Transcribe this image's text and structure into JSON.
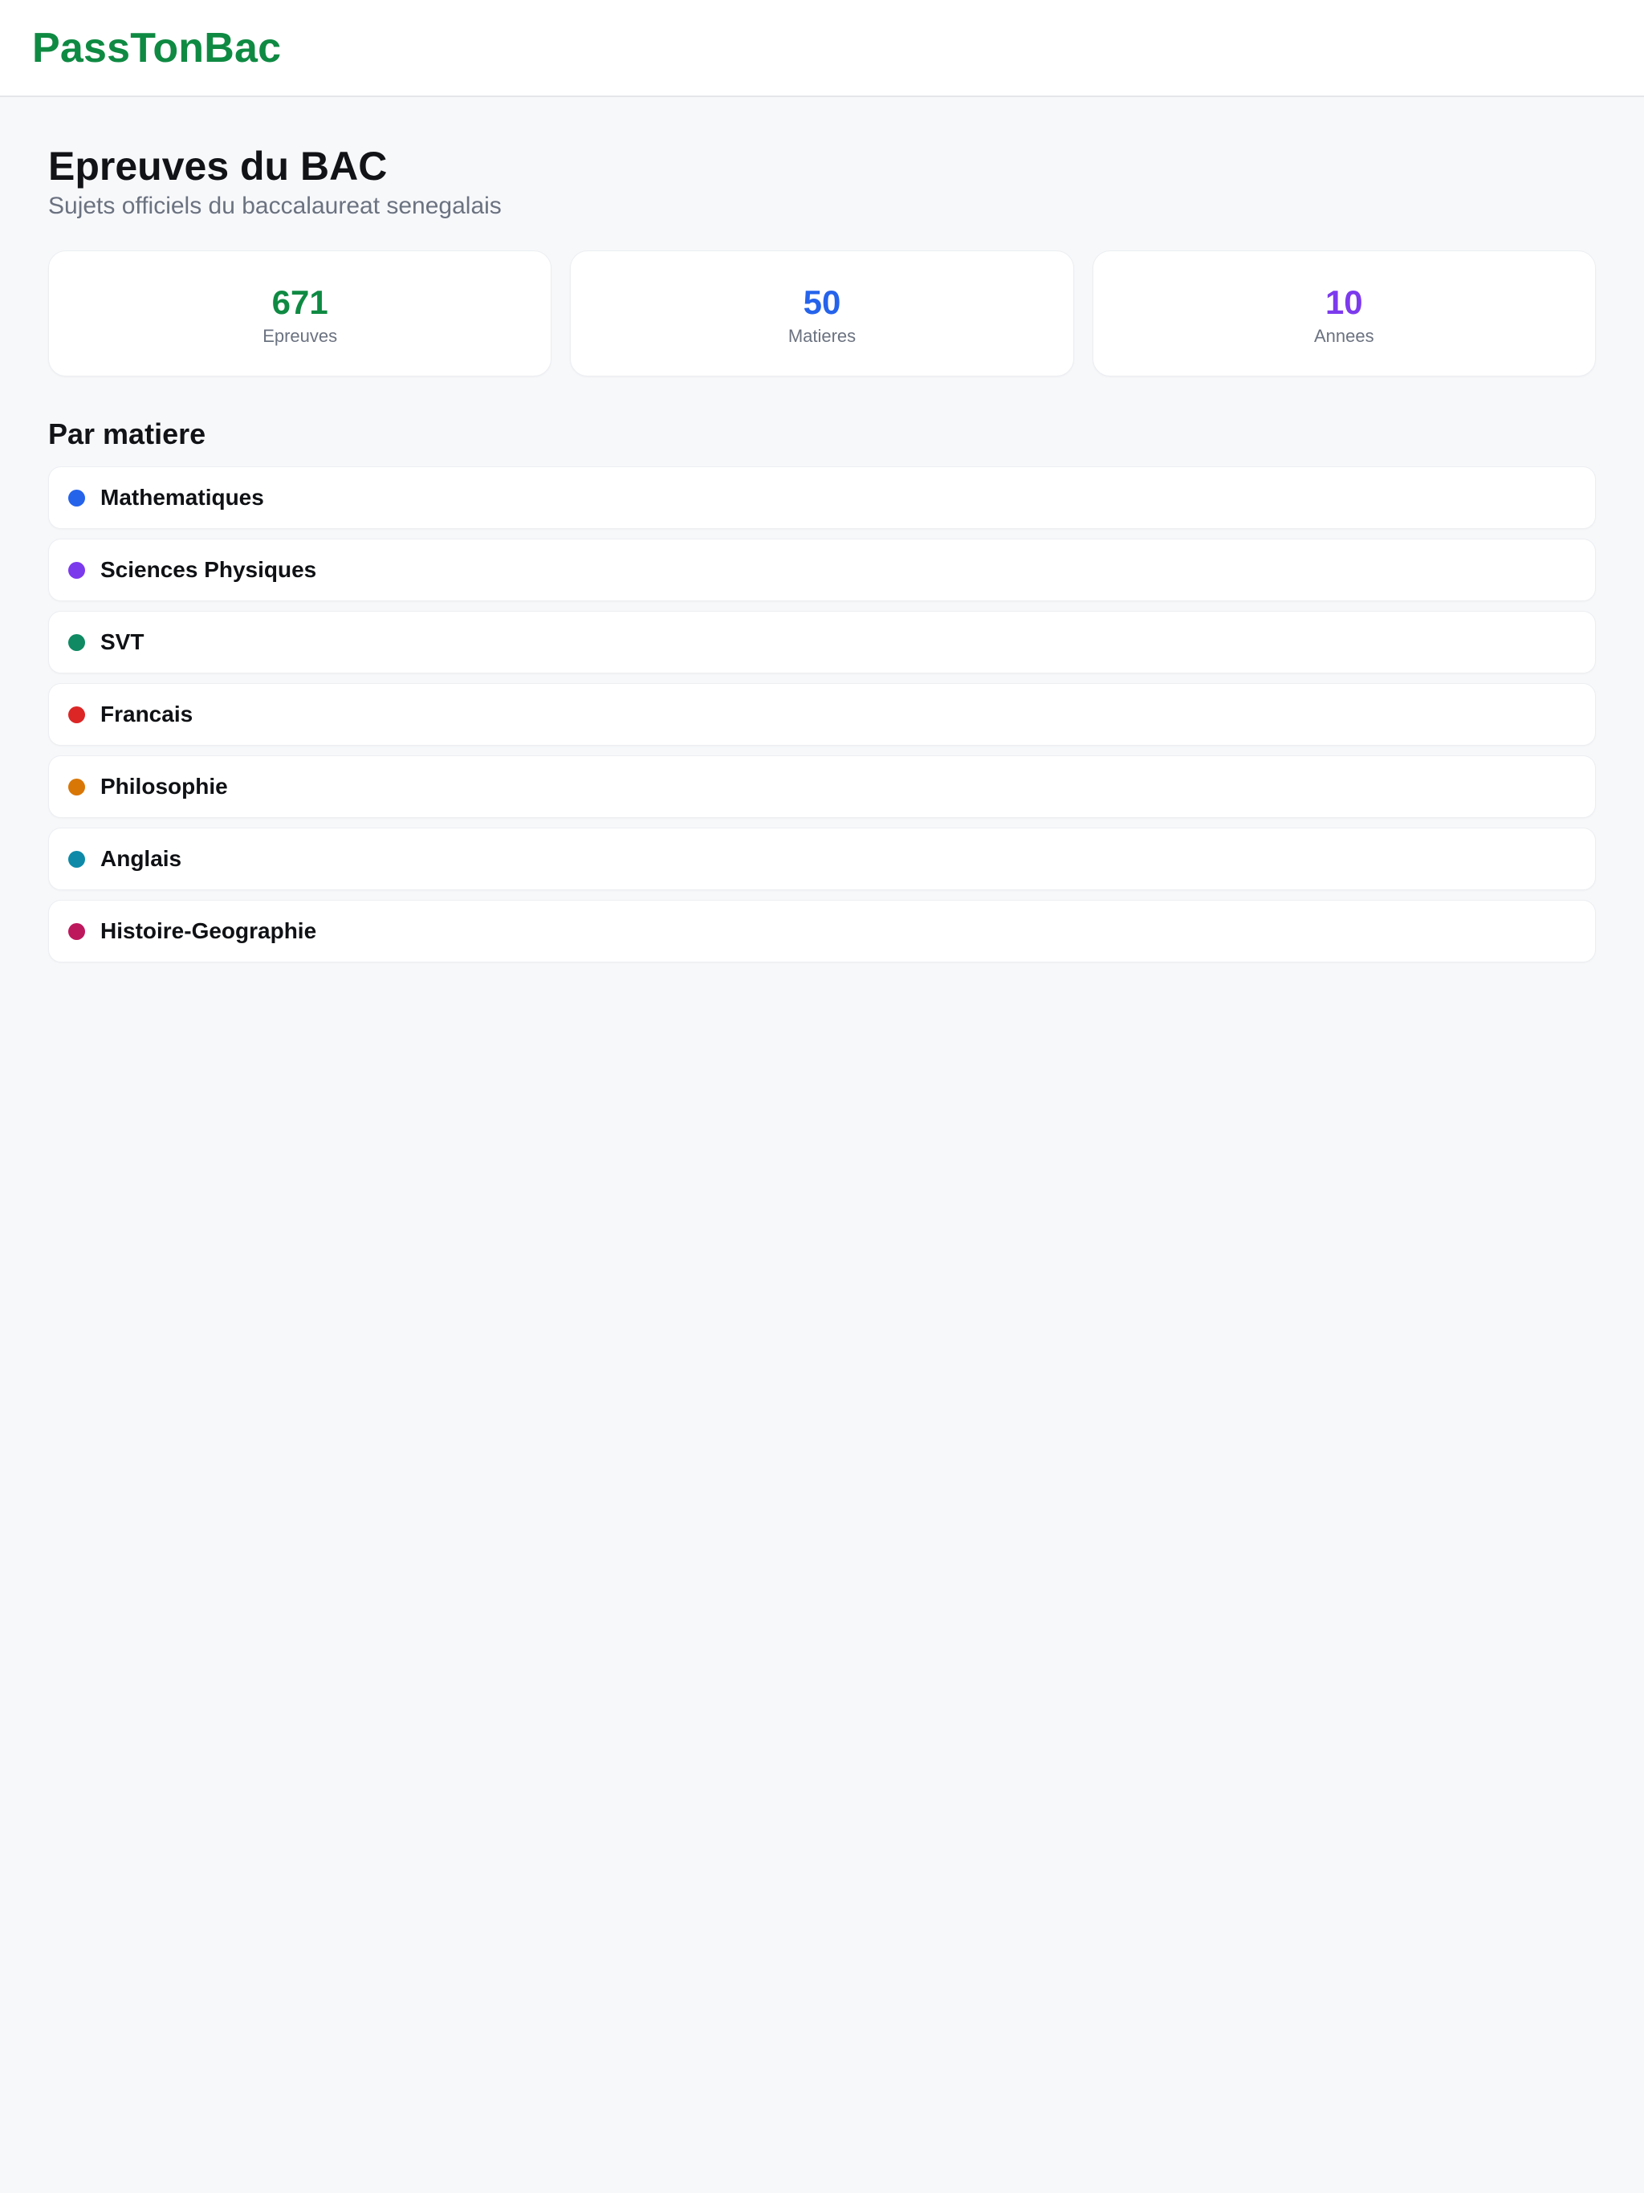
{
  "app": {
    "brand": "PassTonBac",
    "brand_color": "#0f8a43"
  },
  "header": {
    "title": "Epreuves du BAC",
    "subtitle": "Sujets officiels du baccalaureat senegalais"
  },
  "stats": [
    {
      "value": "671",
      "label": "Epreuves",
      "color": "#0f8a43"
    },
    {
      "value": "50",
      "label": "Matieres",
      "color": "#2563eb"
    },
    {
      "value": "10",
      "label": "Annees",
      "color": "#7c3aed"
    }
  ],
  "subjects_section": {
    "title": "Par matiere",
    "items": [
      {
        "name": "Mathematiques",
        "color": "#2563eb"
      },
      {
        "name": "Sciences Physiques",
        "color": "#7c3aed"
      },
      {
        "name": "SVT",
        "color": "#0f8a63"
      },
      {
        "name": "Francais",
        "color": "#dc2626"
      },
      {
        "name": "Philosophie",
        "color": "#d97706"
      },
      {
        "name": "Anglais",
        "color": "#0e8aa8"
      },
      {
        "name": "Histoire-Geographie",
        "color": "#be185d"
      }
    ]
  }
}
